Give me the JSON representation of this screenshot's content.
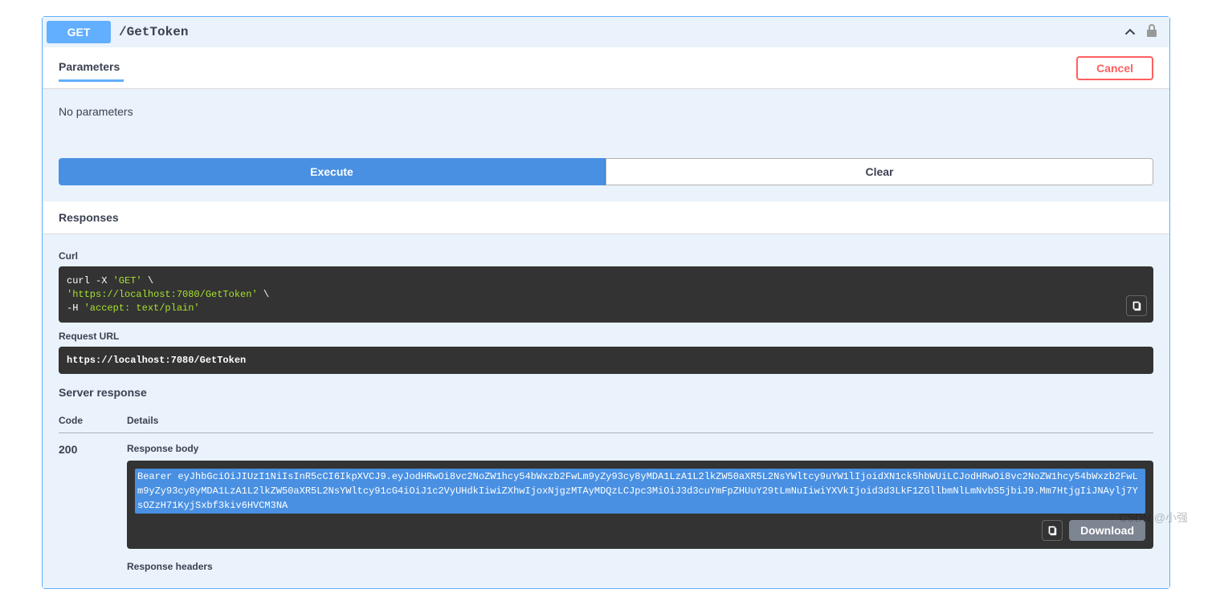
{
  "summary": {
    "method": "GET",
    "path": "/GetToken"
  },
  "tabs": {
    "parameters": "Parameters",
    "cancel": "Cancel"
  },
  "body": {
    "no_params": "No parameters"
  },
  "buttons": {
    "execute": "Execute",
    "clear": "Clear",
    "download": "Download"
  },
  "responses": {
    "title": "Responses",
    "curl_label": "Curl",
    "curl": {
      "l1a": "curl -X ",
      "l1b": "'GET'",
      "l1c": " \\",
      "l2a": "  ",
      "l2b": "'https://localhost:7080/GetToken'",
      "l2c": " \\",
      "l3a": "  -H ",
      "l3b": "'accept: text/plain'"
    },
    "request_url_label": "Request URL",
    "request_url": "https://localhost:7080/GetToken",
    "server_response_label": "Server response",
    "code_header": "Code",
    "details_header": "Details",
    "status_code": "200",
    "response_body_label": "Response body",
    "response_body": "Bearer eyJhbGciOiJIUzI1NiIsInR5cCI6IkpXVCJ9.eyJodHRwOi8vc2NoZW1hcy54bWxzb2FwLm9yZy93cy8yMDA1LzA1L2lkZW50aXR5L2NsYWltcy9uYW1lIjoidXN1ck5hbWUiLCJodHRwOi8vc2NoZW1hcy54bWxzb2FwLm9yZy93cy8yMDA1LzA1L2lkZW50aXR5L2NsYWltcy91cG4iOiJ1c2VyUHdkIiwiZXhwIjoxNjgzMTAyMDQzLCJpc3MiOiJ3d3cuYmFpZHUuY29tLmNuIiwiYXVkIjoid3d3LkF1ZGllbmNlLmNvbS5jbiJ9.Mm7HtjgIiJNAylj7YsOZzH71KyjSxbf3kiv6HVCM3NA",
    "response_headers_label": "Response headers"
  },
  "watermark": "CSDN @小强"
}
